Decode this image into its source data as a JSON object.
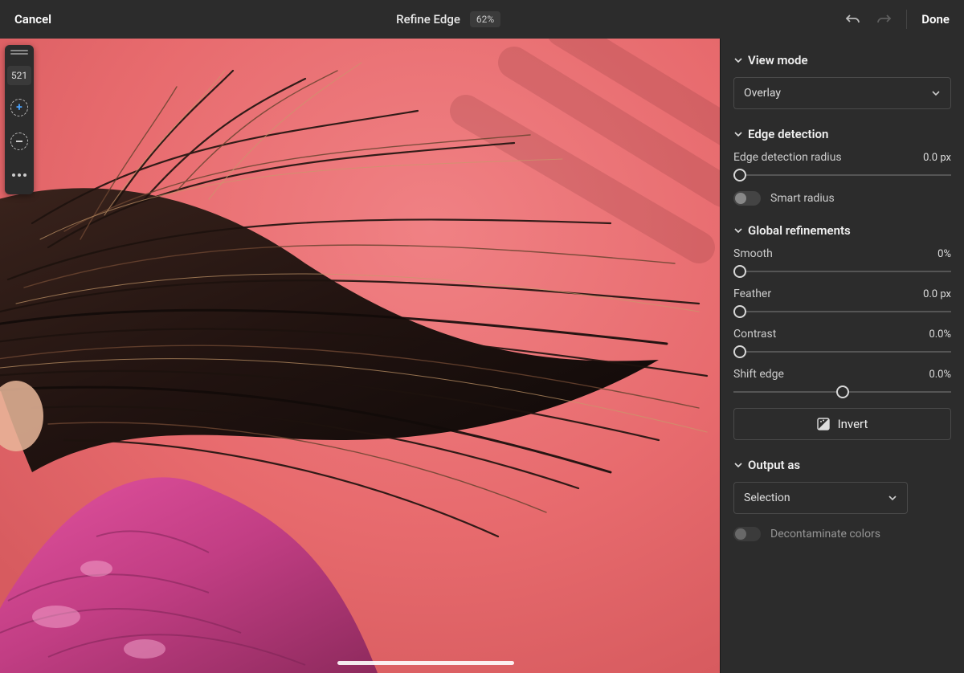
{
  "topbar": {
    "cancel": "Cancel",
    "title": "Refine Edge",
    "zoom": "62%",
    "done": "Done"
  },
  "toolstrip": {
    "brush_size": "521"
  },
  "panel": {
    "view_mode": {
      "title": "View mode",
      "selected": "Overlay"
    },
    "edge_detection": {
      "title": "Edge detection",
      "radius_label": "Edge detection radius",
      "radius_value": "0.0 px",
      "smart_radius_label": "Smart radius",
      "smart_radius_on": false
    },
    "global_refinements": {
      "title": "Global refinements",
      "smooth": {
        "label": "Smooth",
        "value": "0%",
        "pos": 0
      },
      "feather": {
        "label": "Feather",
        "value": "0.0 px",
        "pos": 0
      },
      "contrast": {
        "label": "Contrast",
        "value": "0.0%",
        "pos": 0
      },
      "shift_edge": {
        "label": "Shift edge",
        "value": "0.0%",
        "pos": 50
      },
      "invert": "Invert"
    },
    "output": {
      "title": "Output as",
      "selected": "Selection",
      "decontaminate_label": "Decontaminate colors",
      "decontaminate_on": false
    }
  }
}
